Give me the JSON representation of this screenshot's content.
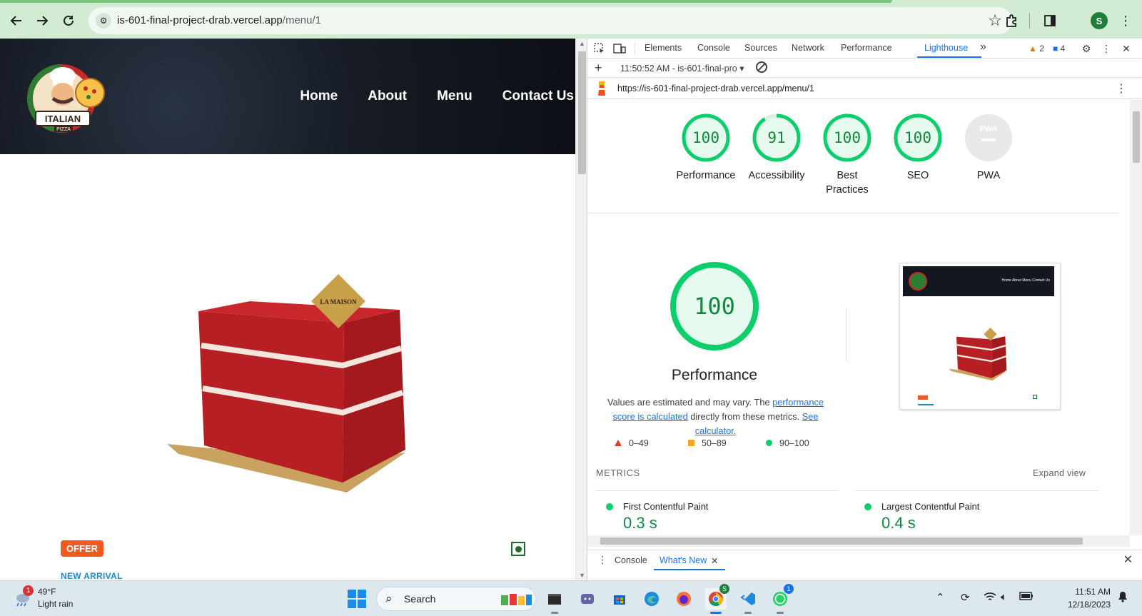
{
  "browser": {
    "url_host": "is-601-final-project-drab.vercel.app",
    "url_path": "/menu/1"
  },
  "site": {
    "nav": [
      "Home",
      "About",
      "Menu",
      "Contact Us"
    ],
    "logo_text": "ITALIAN PIZZA",
    "cake_label": "LA MAISON",
    "offer_badge": "OFFER",
    "new_arrival": "NEW ARRIVAL"
  },
  "devtools": {
    "tabs": [
      "Elements",
      "Console",
      "Sources",
      "Network",
      "Performance",
      "Lighthouse"
    ],
    "more_tabs": "»",
    "warning_count": "2",
    "message_count": "4",
    "report_select": "11:50:52 AM - is-601-final-pro",
    "report_url": "https://is-601-final-project-drab.vercel.app/menu/1",
    "drawer_tabs": [
      "Console",
      "What's New"
    ]
  },
  "lighthouse": {
    "scores": [
      {
        "label": "Performance",
        "score": "100",
        "value": 100
      },
      {
        "label": "Accessibility",
        "score": "91",
        "value": 91
      },
      {
        "label": "Best Practices",
        "score": "100",
        "value": 100
      },
      {
        "label": "SEO",
        "score": "100",
        "value": 100
      },
      {
        "label": "PWA",
        "score": "PWA",
        "value": null
      }
    ],
    "perf_score": "100",
    "perf_title": "Performance",
    "desc_prefix": "Values are estimated and may vary. The ",
    "desc_link1": "performance score is calculated",
    "desc_middle": " directly from these metrics. ",
    "desc_link2": "See calculator.",
    "legend": [
      "0–49",
      "50–89",
      "90–100"
    ],
    "metrics_title": "METRICS",
    "expand_view": "Expand view",
    "metrics": [
      {
        "name": "First Contentful Paint",
        "value": "0.3 s"
      },
      {
        "name": "Largest Contentful Paint",
        "value": "0.4 s"
      }
    ],
    "thumb_nav": "Home   About   Menu   Contact Us",
    "colors": {
      "pass": "#0cce6b",
      "average": "#ffa400",
      "fail": "#ff4e42"
    }
  },
  "taskbar": {
    "weather_temp": "49°F",
    "weather_desc": "Light rain",
    "weather_badge": "1",
    "search_label": "Search",
    "whatsapp_badge": "1",
    "chrome_profile_badge": "S",
    "time": "11:51 AM",
    "date": "12/18/2023"
  },
  "profile_initial": "S"
}
